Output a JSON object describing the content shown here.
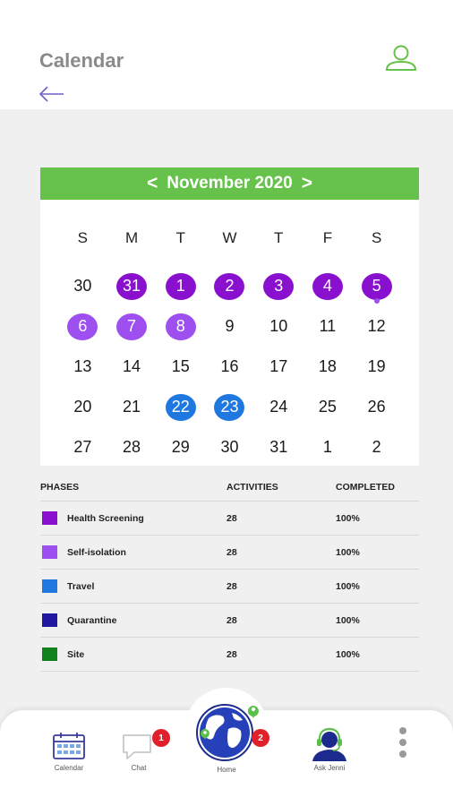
{
  "header": {
    "title": "Calendar"
  },
  "calendar": {
    "month_label": "November 2020",
    "prev": "<",
    "next": ">",
    "weekdays": [
      "S",
      "M",
      "T",
      "W",
      "T",
      "F",
      "S"
    ],
    "days": [
      "30",
      "31",
      "1",
      "2",
      "3",
      "4",
      "5",
      "6",
      "7",
      "8",
      "9",
      "10",
      "11",
      "12",
      "13",
      "14",
      "15",
      "16",
      "17",
      "18",
      "19",
      "20",
      "21",
      "22",
      "23",
      "24",
      "25",
      "26",
      "27",
      "28",
      "29",
      "30",
      "31",
      "1",
      "2"
    ],
    "day_styles": [
      "",
      "p1",
      "p1",
      "p1",
      "p1",
      "p1",
      "p1 dot",
      "p2",
      "p2",
      "p2",
      "",
      "",
      "",
      "",
      "",
      "",
      "",
      "",
      "",
      "",
      "",
      "",
      "",
      "sel",
      "sel",
      "",
      "",
      "",
      "",
      "",
      "",
      "",
      "",
      "",
      ""
    ]
  },
  "phases": {
    "headers": {
      "phase": "PHASES",
      "activities": "ACTIVITIES",
      "completed": "COMPLETED"
    },
    "rows": [
      {
        "name": "Health Screening",
        "activities": "28",
        "completed": "100%",
        "color": "#8a10d0"
      },
      {
        "name": "Self-isolation",
        "activities": "28",
        "completed": "100%",
        "color": "#9e4ff0"
      },
      {
        "name": "Travel",
        "activities": "28",
        "completed": "100%",
        "color": "#1e78e0"
      },
      {
        "name": "Quarantine",
        "activities": "28",
        "completed": "100%",
        "color": "#2016a0"
      },
      {
        "name": "Site",
        "activities": "28",
        "completed": "100%",
        "color": "#12821e"
      }
    ]
  },
  "nav": {
    "calendar": "Calendar",
    "chat": "Chat",
    "chat_badge": "1",
    "home": "Home",
    "home_badge": "2",
    "ask": "Ask Jenni"
  },
  "colors": {
    "accent_green": "#66c24a",
    "phase_purple": "#8a10d0",
    "phase_violet": "#9e4ff0",
    "selected_blue": "#1e78e0",
    "badge_red": "#e0202a"
  }
}
